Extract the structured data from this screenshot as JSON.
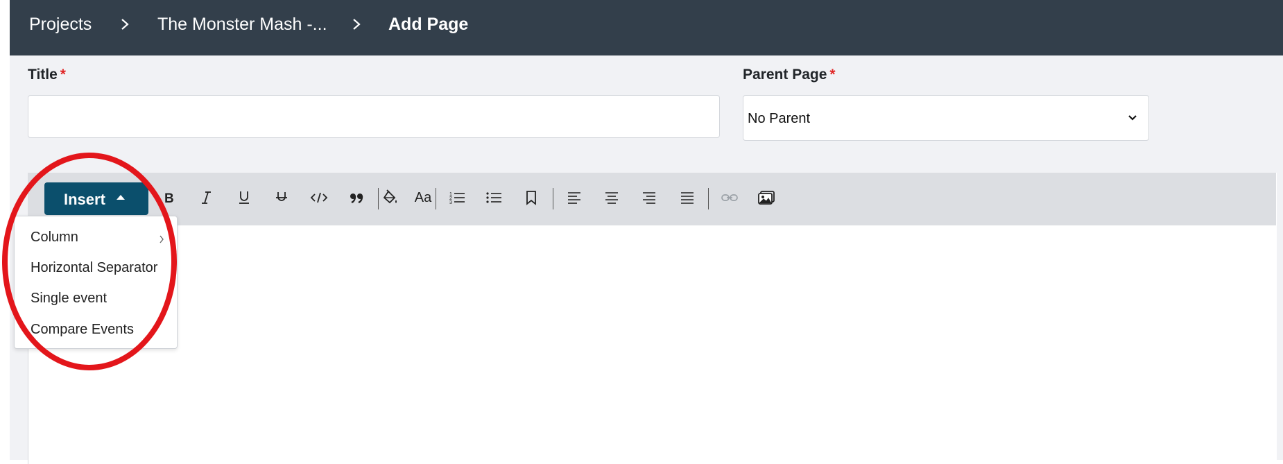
{
  "breadcrumb": {
    "items": [
      "Projects",
      "The Monster Mash -...",
      "Add Page"
    ]
  },
  "form": {
    "title_label": "Title",
    "required_marker": "*",
    "title_value": "",
    "parent_label": "Parent Page",
    "parent_value": "No Parent"
  },
  "toolbar": {
    "insert_label": "Insert",
    "font_size_label": "Aa",
    "buttons": [
      "bold",
      "italic",
      "underline",
      "strikethrough",
      "code",
      "quote",
      "text-color",
      "font-size",
      "ordered-list",
      "bullet-list",
      "bookmark",
      "align-left",
      "align-center",
      "align-right",
      "align-justify",
      "link",
      "image"
    ]
  },
  "insert_menu": {
    "items": [
      "Column",
      "Horizontal Separator",
      "Single event",
      "Compare Events"
    ]
  },
  "colors": {
    "topbar": "#333f4b",
    "insert_button": "#0b4f6c",
    "required": "#e02424",
    "annotation": "#e3161b"
  }
}
